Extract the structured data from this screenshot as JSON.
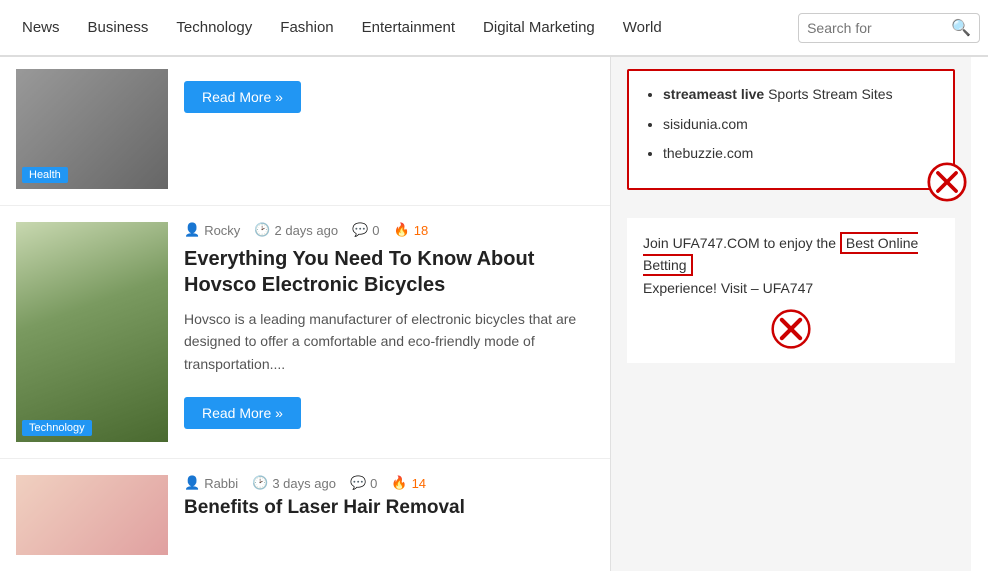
{
  "nav": {
    "items": [
      {
        "label": "News",
        "active": true
      },
      {
        "label": "Business"
      },
      {
        "label": "Technology"
      },
      {
        "label": "Fashion"
      },
      {
        "label": "Entertainment"
      },
      {
        "label": "Digital Marketing"
      },
      {
        "label": "World"
      }
    ],
    "search_placeholder": "Search for"
  },
  "article_top": {
    "tag": "Health",
    "read_more_label": "Read More »"
  },
  "article_main": {
    "author": "Rocky",
    "time": "2 days ago",
    "comments": "0",
    "fire": "18",
    "title": "Everything You Need To Know About Hovsco Electronic Bicycles",
    "excerpt": "Hovsco is a leading manufacturer of electronic bicycles that are designed to offer a comfortable and eco-friendly mode of transportation....",
    "tag": "Technology",
    "read_more_label": "Read More »"
  },
  "article_bottom": {
    "author": "Rabbi",
    "time": "3 days ago",
    "comments": "0",
    "fire": "14",
    "title": "Benefits of Laser Hair Removal"
  },
  "sidebar": {
    "ad1": {
      "items": [
        {
          "text_bold": "streameast live",
          "text_rest": " Sports Stream Sites"
        },
        {
          "text_bold": "",
          "text_rest": "sisidunia.com"
        },
        {
          "text_bold": "",
          "text_rest": "thebuzzie.com"
        }
      ]
    },
    "ad2": {
      "text_before": "Join UFA747.COM to enjoy the",
      "highlight": "Best Online Betting",
      "text_after": "Experience! Visit – UFA747"
    }
  }
}
